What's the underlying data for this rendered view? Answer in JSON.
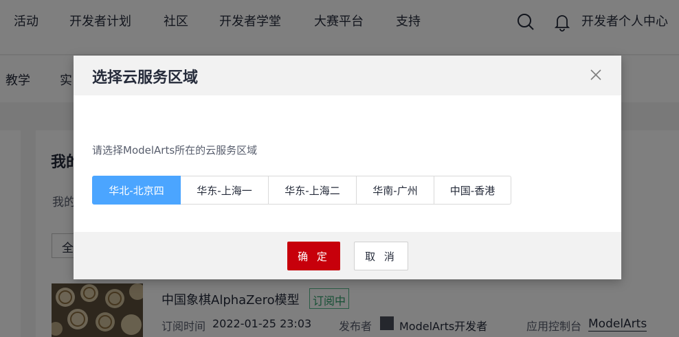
{
  "topnav": {
    "items": [
      "活动",
      "开发者计划",
      "社区",
      "开发者学堂",
      "大赛平台",
      "支持"
    ],
    "search_icon": "search-icon",
    "bell_icon": "bell-icon",
    "user_center": "开发者个人中心"
  },
  "subnav": {
    "items": [
      "教学",
      "实"
    ]
  },
  "page": {
    "heading": "我的",
    "subtab": "我的",
    "filter": "全"
  },
  "item": {
    "title": "中国象棋AlphaZero模型",
    "badge": "订阅中",
    "subscribe_label": "订阅时间",
    "subscribe_time": "2022-01-25 23:03",
    "publisher_label": "发布者",
    "publisher": "ModelArts开发者",
    "console_label": "应用控制台",
    "console_link": "ModelArts"
  },
  "modal": {
    "title": "选择云服务区域",
    "prompt": "请选择ModelArts所在的云服务区域",
    "regions": [
      "华北-北京四",
      "华东-上海一",
      "华东-上海二",
      "华南-广州",
      "中国-香港"
    ],
    "selected_region": "华北-北京四",
    "confirm_label": "确 定",
    "cancel_label": "取 消"
  },
  "colors": {
    "accent": "#4ba5ff",
    "primary_button": "#c7000b",
    "badge": "#2d9e6a"
  }
}
